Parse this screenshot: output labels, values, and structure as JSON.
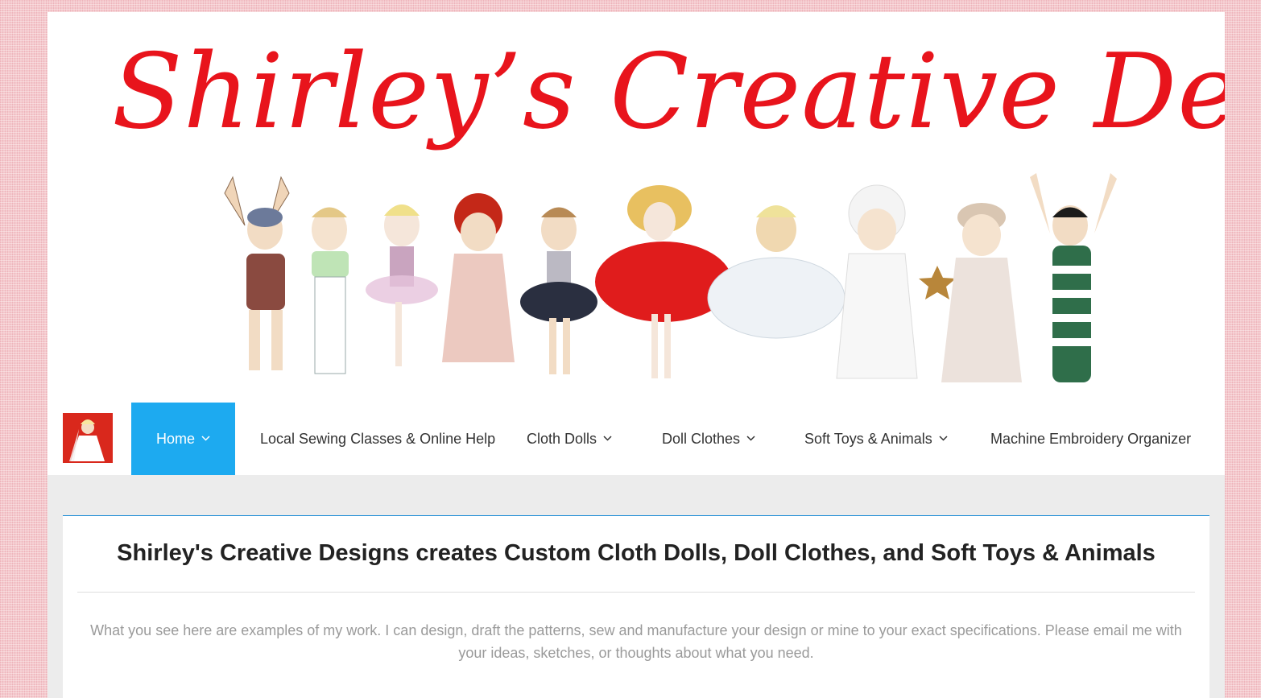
{
  "header": {
    "logo_text": "Shirley’s Creative Designs",
    "banner_image": "doll-lineup-illustration"
  },
  "nav": {
    "logo_image": "bride-doll-thumbnail",
    "items": [
      {
        "label": "Home",
        "has_dropdown": true,
        "active": true
      },
      {
        "label": "Local Sewing Classes & Online Help",
        "has_dropdown": false,
        "active": false
      },
      {
        "label": "Cloth Dolls",
        "has_dropdown": true,
        "active": false
      },
      {
        "label": "Doll Clothes",
        "has_dropdown": true,
        "active": false
      },
      {
        "label": "Soft Toys & Animals",
        "has_dropdown": true,
        "active": false
      },
      {
        "label": "Machine Embroidery Organizer",
        "has_dropdown": false,
        "active": false
      }
    ]
  },
  "main": {
    "title": "Shirley's Creative Designs creates Custom Cloth Dolls, Doll Clothes, and Soft Toys & Animals",
    "description": "What you see here are examples of my work. I can design, draft the patterns, sew and manufacture your design or mine to your exact specifications. Please email me with your ideas, sketches, or thoughts about what you need."
  },
  "colors": {
    "accent": "#1daaf0",
    "logo_red": "#e8141c",
    "background_pink": "#f4c9cd",
    "title_text": "#222222",
    "body_text": "#9a9a9a"
  },
  "icons": {
    "dropdown": "chevron-down-icon"
  }
}
